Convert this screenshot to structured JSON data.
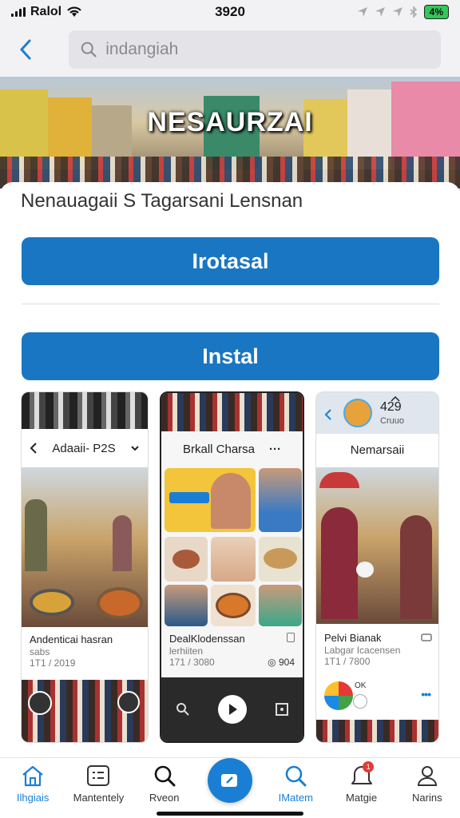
{
  "status": {
    "carrier": "Ralol",
    "time": "3920",
    "battery": "4%"
  },
  "search": {
    "value": "indangiah"
  },
  "hero": {
    "title": "NESAURZAI"
  },
  "app": {
    "name": "Nenauagaii S Tagarsani Lensnan",
    "open_label": "Irotasal",
    "install_label": "Instal"
  },
  "screenshots": {
    "s1": {
      "header": "Adaaii- P2S",
      "caption_title": "Andenticai hasran",
      "caption_sub": "sabs",
      "caption_meta": "1T1 / 2019"
    },
    "s2": {
      "header": "Brkall Charsa",
      "caption_title": "DealKlodenssan",
      "caption_sub": "lerhiiten",
      "caption_meta": "171 / 3080",
      "caption_count": "904"
    },
    "s3": {
      "count": "429",
      "count_sub": "Cruuo",
      "header": "Nemarsaii",
      "caption_title": "Pelvi Bianak",
      "caption_sub": "Labgar Icacensen",
      "caption_meta": "1T1 / 7800",
      "ok_label": "OK"
    }
  },
  "tabs": [
    {
      "label": "Ilhgiais",
      "icon": "home-icon",
      "active": true
    },
    {
      "label": "Mantentely",
      "icon": "list-icon",
      "active": false
    },
    {
      "label": "Rveon",
      "icon": "search-icon",
      "active": false
    },
    {
      "label": "",
      "icon": "camera-icon",
      "active": false
    },
    {
      "label": "IMatem",
      "icon": "search-icon",
      "active": true
    },
    {
      "label": "Matgie",
      "icon": "bell-icon",
      "active": false,
      "badge": "1"
    },
    {
      "label": "Narins",
      "icon": "user-icon",
      "active": false
    }
  ],
  "colors": {
    "accent": "#1a7fd4",
    "button": "#1976c2"
  }
}
